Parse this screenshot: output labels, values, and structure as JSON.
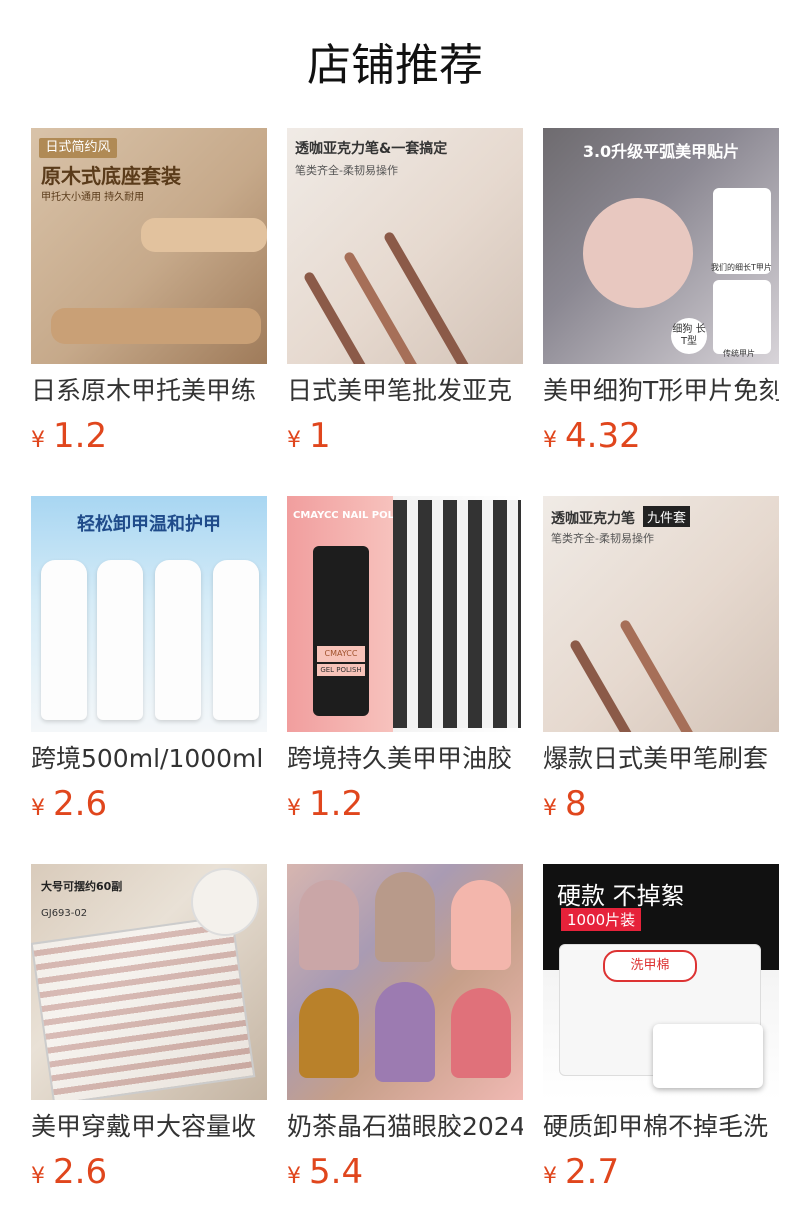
{
  "page": {
    "title": "店铺推荐"
  },
  "products": [
    {
      "name": "日系原木甲托美甲练",
      "price": "1.2",
      "currency": "¥",
      "image_text": [
        "日式简约风",
        "原木式底座套装",
        "甲托大小通用 持久耐用"
      ]
    },
    {
      "name": "日式美甲笔批发亚克",
      "price": "1",
      "currency": "¥",
      "image_text": [
        "透咖亚克力笔&一套搞定",
        "笔类齐全-柔韧易操作"
      ]
    },
    {
      "name": "美甲细狗T形甲片免刻",
      "price": "4.32",
      "currency": "¥",
      "image_text": [
        "3.0升级平弧美甲贴片",
        "我们的细长T甲片",
        "传统甲片",
        "细狗 长T型"
      ]
    },
    {
      "name": "跨境500ml/1000ml",
      "price": "2.6",
      "currency": "¥",
      "image_text": [
        "轻松卸甲温和护甲"
      ]
    },
    {
      "name": "跨境持久美甲甲油胶",
      "price": "1.2",
      "currency": "¥",
      "image_text": [
        "CMAYCC NAIL POLISH",
        "CMAYCC",
        "GEL POLISH"
      ]
    },
    {
      "name": "爆款日式美甲笔刷套",
      "price": "8",
      "currency": "¥",
      "image_text": [
        "透咖亚克力笔",
        "九件套",
        "笔类齐全-柔韧易操作"
      ]
    },
    {
      "name": "美甲穿戴甲大容量收",
      "price": "2.6",
      "currency": "¥",
      "image_text": [
        "大号可摆约60副",
        "GJ693-02"
      ]
    },
    {
      "name": "奶茶晶石猫眼胶2024",
      "price": "5.4",
      "currency": "¥",
      "image_text": []
    },
    {
      "name": "硬质卸甲棉不掉毛洗",
      "price": "2.7",
      "currency": "¥",
      "image_text": [
        "硬款 不掉絮",
        "1000片装",
        "洗甲棉"
      ]
    }
  ],
  "colors": {
    "price": "#e0461d",
    "title": "#111111",
    "name": "#333333"
  }
}
